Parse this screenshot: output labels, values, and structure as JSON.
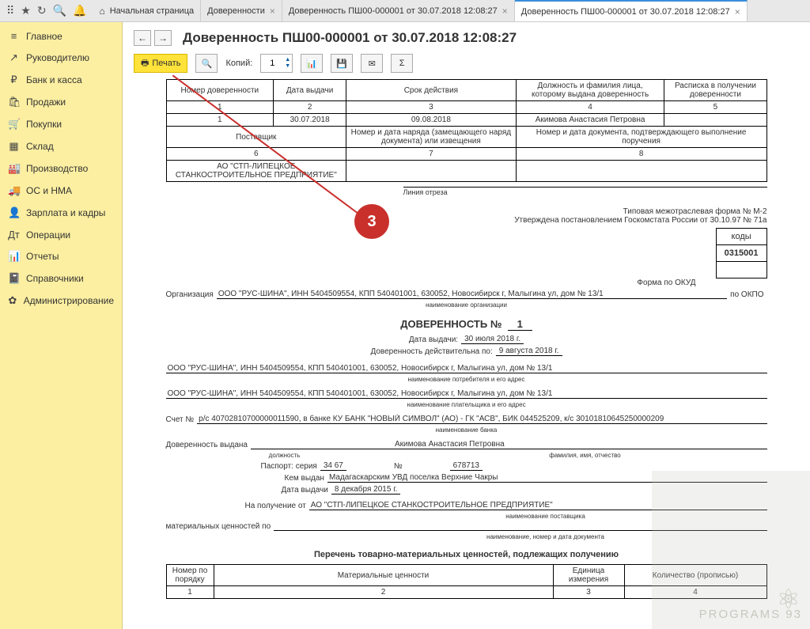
{
  "topbar_icons": [
    "apps",
    "star",
    "cube",
    "search",
    "bell"
  ],
  "tabs": [
    {
      "label": "Начальная страница",
      "home": true
    },
    {
      "label": "Доверенности",
      "closable": true
    },
    {
      "label": "Доверенность ПШ00-000001 от 30.07.2018 12:08:27",
      "closable": true
    },
    {
      "label": "Доверенность ПШ00-000001 от 30.07.2018 12:08:27",
      "closable": true,
      "active": true
    }
  ],
  "sidebar": [
    {
      "icon": "≡",
      "label": "Главное"
    },
    {
      "icon": "↗",
      "label": "Руководителю"
    },
    {
      "icon": "₽",
      "label": "Банк и касса"
    },
    {
      "icon": "🛍",
      "label": "Продажи"
    },
    {
      "icon": "🛒",
      "label": "Покупки"
    },
    {
      "icon": "▦",
      "label": "Склад"
    },
    {
      "icon": "🏭",
      "label": "Производство"
    },
    {
      "icon": "🚚",
      "label": "ОС и НМА"
    },
    {
      "icon": "👤",
      "label": "Зарплата и кадры"
    },
    {
      "icon": "Дт",
      "label": "Операции"
    },
    {
      "icon": "📊",
      "label": "Отчеты"
    },
    {
      "icon": "📓",
      "label": "Справочники"
    },
    {
      "icon": "✿",
      "label": "Администрирование"
    }
  ],
  "title": "Доверенность ПШ00-000001 от 30.07.2018 12:08:27",
  "toolbar": {
    "print": "Печать",
    "copies": "Копий:",
    "copies_val": "1"
  },
  "table1": {
    "h": [
      "Номер доверенности",
      "Дата выдачи",
      "Срок действия",
      "Должность и фамилия лица, которому выдана доверенность",
      "Расписка в получении доверенности"
    ],
    "n": [
      "1",
      "2",
      "3",
      "4",
      "5"
    ],
    "r": [
      "1",
      "30.07.2018",
      "09.08.2018",
      "Акимова Анастасия Петровна",
      ""
    ],
    "h2": [
      "Поставщик",
      "Номер и дата наряда (замещающего наряд документа) или извещения",
      "Номер и дата документа, подтверждающего выполнение поручения"
    ],
    "n2": [
      "6",
      "7",
      "8"
    ],
    "r2": [
      "АО \"СТП-ЛИПЕЦКОЕ СТАНКОСТРОИТЕЛЬНОЕ ПРЕДПРИЯТИЕ\"",
      "",
      ""
    ]
  },
  "cut": "Линия отреза",
  "meta1": "Типовая межотраслевая форма № М-2",
  "meta2": "Утверждена постановлением Госкомстата России от 30.10.97 № 71а",
  "codes": {
    "hdr": "коды",
    "okud_lbl": "Форма по ОКУД",
    "okud": "0315001",
    "okpo_lbl": "по ОКПО"
  },
  "org_lbl": "Организация",
  "org_val": "ООО \"РУС-ШИНА\", ИНН 5404509554, КПП 540401001, 630052, Новосибирск г, Малыгина ул, дом № 13/1",
  "org_sub": "наименование организации",
  "dov_hdr": "ДОВЕРЕННОСТЬ №",
  "dov_no": "1",
  "date_lbl": "Дата выдачи:",
  "date_val": "30 июля 2018 г.",
  "valid_lbl": "Доверенность действительна по:",
  "valid_val": "9 августа 2018 г.",
  "consumer": "ООО \"РУС-ШИНА\", ИНН 5404509554, КПП 540401001, 630052, Новосибирск г, Малыгина ул, дом № 13/1",
  "consumer_sub": "наименование потребителя и его адрес",
  "payer": "ООО \"РУС-ШИНА\", ИНН 5404509554, КПП 540401001, 630052, Новосибирск г, Малыгина ул, дом № 13/1",
  "payer_sub": "наименование плательщика и его адрес",
  "acct_lbl": "Счет №",
  "acct": "р/с 40702810700000011590, в банке КУ БАНК \"НОВЫЙ СИМВОЛ\" (АО) - ГК \"АСВ\", БИК 044525209, к/с 30101810645250000209",
  "bank_sub": "наименование банка",
  "issued_lbl": "Доверенность выдана",
  "issued_pos_sub": "должность",
  "issued_name": "Акимова Анастасия Петровна",
  "issued_name_sub": "фамилия, имя, отчество",
  "pass_lbl": "Паспорт: серия",
  "pass_s": "34 67",
  "pass_no_lbl": "№",
  "pass_no": "678713",
  "pass_by_lbl": "Кем выдан",
  "pass_by": "Мадагаскарским УВД поселка Верхние Чакры",
  "pass_date_lbl": "Дата выдачи",
  "pass_date": "8 декабря 2015 г.",
  "recv_lbl": "На получение от",
  "recv": "АО \"СТП-ЛИПЕЦКОЕ СТАНКОСТРОИТЕЛЬНОЕ ПРЕДПРИЯТИЕ\"",
  "recv_sub": "наименование поставщика",
  "mat_lbl": "материальных ценностей по",
  "mat_sub": "наименование, номер и дата документа",
  "list_hdr": "Перечень товарно-материальных ценностей, подлежащих получению",
  "table2": {
    "h": [
      "Номер по порядку",
      "Материальные ценности",
      "Единица измерения",
      "Количество (прописью)"
    ],
    "n": [
      "1",
      "2",
      "3",
      "4"
    ]
  },
  "callout": "3",
  "brand": "PROGRAMS 93"
}
